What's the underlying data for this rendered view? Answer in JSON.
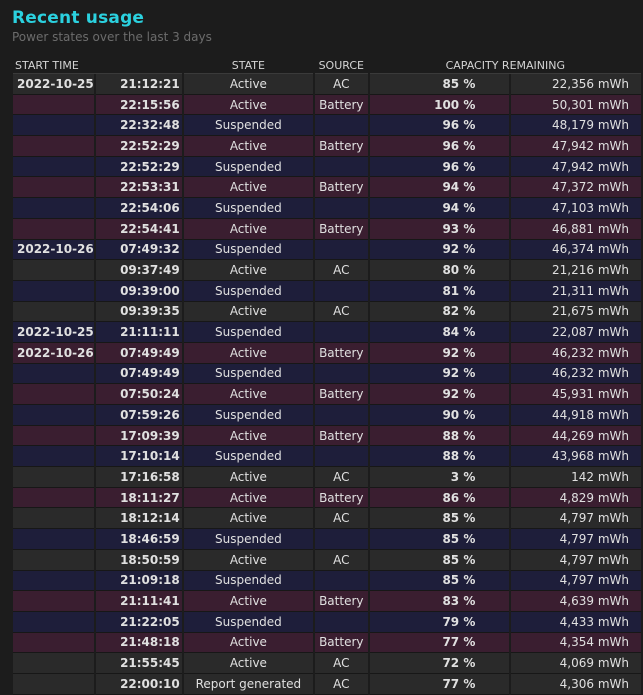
{
  "header": {
    "title": "Recent usage",
    "subtitle": "Power states over the last 3 days"
  },
  "table": {
    "columns": [
      "START TIME",
      "STATE",
      "SOURCE",
      "CAPACITY REMAINING"
    ],
    "rows": [
      {
        "date": "2022-10-25",
        "time": "21:12:21",
        "state": "Active",
        "source": "AC",
        "pct": "85 %",
        "mwh": "22,356 mWh",
        "bg": "#2a2a2a"
      },
      {
        "date": "",
        "time": "22:15:56",
        "state": "Active",
        "source": "Battery",
        "pct": "100 %",
        "mwh": "50,301 mWh",
        "bg": "#3a1e30"
      },
      {
        "date": "",
        "time": "22:32:48",
        "state": "Suspended",
        "source": "",
        "pct": "96 %",
        "mwh": "48,179 mWh",
        "bg": "#1e1e3a"
      },
      {
        "date": "",
        "time": "22:52:29",
        "state": "Active",
        "source": "Battery",
        "pct": "96 %",
        "mwh": "47,942 mWh",
        "bg": "#3a1e30"
      },
      {
        "date": "",
        "time": "22:52:29",
        "state": "Suspended",
        "source": "",
        "pct": "96 %",
        "mwh": "47,942 mWh",
        "bg": "#1e1e3a"
      },
      {
        "date": "",
        "time": "22:53:31",
        "state": "Active",
        "source": "Battery",
        "pct": "94 %",
        "mwh": "47,372 mWh",
        "bg": "#3a1e30"
      },
      {
        "date": "",
        "time": "22:54:06",
        "state": "Suspended",
        "source": "",
        "pct": "94 %",
        "mwh": "47,103 mWh",
        "bg": "#1e1e3a"
      },
      {
        "date": "",
        "time": "22:54:41",
        "state": "Active",
        "source": "Battery",
        "pct": "93 %",
        "mwh": "46,881 mWh",
        "bg": "#3a1e30"
      },
      {
        "date": "2022-10-26",
        "time": "07:49:32",
        "state": "Suspended",
        "source": "",
        "pct": "92 %",
        "mwh": "46,374 mWh",
        "bg": "#1e1e3a"
      },
      {
        "date": "",
        "time": "09:37:49",
        "state": "Active",
        "source": "AC",
        "pct": "80 %",
        "mwh": "21,216 mWh",
        "bg": "#2a2a2a"
      },
      {
        "date": "",
        "time": "09:39:00",
        "state": "Suspended",
        "source": "",
        "pct": "81 %",
        "mwh": "21,311 mWh",
        "bg": "#1e1e3a"
      },
      {
        "date": "",
        "time": "09:39:35",
        "state": "Active",
        "source": "AC",
        "pct": "82 %",
        "mwh": "21,675 mWh",
        "bg": "#2a2a2a"
      },
      {
        "date": "2022-10-25",
        "time": "21:11:11",
        "state": "Suspended",
        "source": "",
        "pct": "84 %",
        "mwh": "22,087 mWh",
        "bg": "#1e1e3a"
      },
      {
        "date": "2022-10-26",
        "time": "07:49:49",
        "state": "Active",
        "source": "Battery",
        "pct": "92 %",
        "mwh": "46,232 mWh",
        "bg": "#3a1e30"
      },
      {
        "date": "",
        "time": "07:49:49",
        "state": "Suspended",
        "source": "",
        "pct": "92 %",
        "mwh": "46,232 mWh",
        "bg": "#1e1e3a"
      },
      {
        "date": "",
        "time": "07:50:24",
        "state": "Active",
        "source": "Battery",
        "pct": "92 %",
        "mwh": "45,931 mWh",
        "bg": "#3a1e30"
      },
      {
        "date": "",
        "time": "07:59:26",
        "state": "Suspended",
        "source": "",
        "pct": "90 %",
        "mwh": "44,918 mWh",
        "bg": "#1e1e3a"
      },
      {
        "date": "",
        "time": "17:09:39",
        "state": "Active",
        "source": "Battery",
        "pct": "88 %",
        "mwh": "44,269 mWh",
        "bg": "#3a1e30"
      },
      {
        "date": "",
        "time": "17:10:14",
        "state": "Suspended",
        "source": "",
        "pct": "88 %",
        "mwh": "43,968 mWh",
        "bg": "#1e1e3a"
      },
      {
        "date": "",
        "time": "17:16:58",
        "state": "Active",
        "source": "AC",
        "pct": "3 %",
        "mwh": "142 mWh",
        "bg": "#2a2a2a"
      },
      {
        "date": "",
        "time": "18:11:27",
        "state": "Active",
        "source": "Battery",
        "pct": "86 %",
        "mwh": "4,829 mWh",
        "bg": "#3a1e30"
      },
      {
        "date": "",
        "time": "18:12:14",
        "state": "Active",
        "source": "AC",
        "pct": "85 %",
        "mwh": "4,797 mWh",
        "bg": "#2a2a2a"
      },
      {
        "date": "",
        "time": "18:46:59",
        "state": "Suspended",
        "source": "",
        "pct": "85 %",
        "mwh": "4,797 mWh",
        "bg": "#1e1e3a"
      },
      {
        "date": "",
        "time": "18:50:59",
        "state": "Active",
        "source": "AC",
        "pct": "85 %",
        "mwh": "4,797 mWh",
        "bg": "#2a2a2a"
      },
      {
        "date": "",
        "time": "21:09:18",
        "state": "Suspended",
        "source": "",
        "pct": "85 %",
        "mwh": "4,797 mWh",
        "bg": "#1e1e3a"
      },
      {
        "date": "",
        "time": "21:11:41",
        "state": "Active",
        "source": "Battery",
        "pct": "83 %",
        "mwh": "4,639 mWh",
        "bg": "#3a1e30"
      },
      {
        "date": "",
        "time": "21:22:05",
        "state": "Suspended",
        "source": "",
        "pct": "79 %",
        "mwh": "4,433 mWh",
        "bg": "#1e1e3a"
      },
      {
        "date": "",
        "time": "21:48:18",
        "state": "Active",
        "source": "Battery",
        "pct": "77 %",
        "mwh": "4,354 mWh",
        "bg": "#3a1e30"
      },
      {
        "date": "",
        "time": "21:55:45",
        "state": "Active",
        "source": "AC",
        "pct": "72 %",
        "mwh": "4,069 mWh",
        "bg": "#2a2a2a"
      },
      {
        "date": "",
        "time": "22:00:10",
        "state": "Report generated",
        "source": "AC",
        "pct": "77 %",
        "mwh": "4,306 mWh",
        "bg": "#2a2a2a"
      }
    ]
  },
  "colors": {
    "title": "#2bd1df",
    "background": "#1c1c1c",
    "row_ac": "#2a2a2a",
    "row_suspended": "#1e1e3a",
    "row_battery": "#3a1e30"
  }
}
